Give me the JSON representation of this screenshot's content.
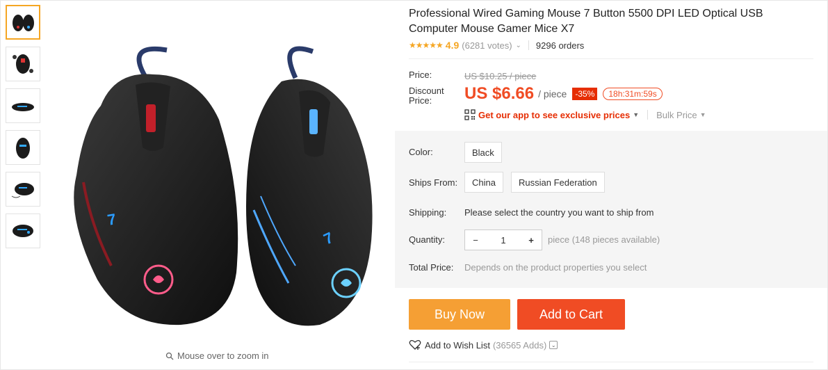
{
  "product": {
    "title": "Professional Wired Gaming Mouse 7 Button 5500 DPI LED Optical USB Computer Mouse Gamer Mice X7",
    "stars": "★★★★★",
    "rating": "4.9",
    "votes": "(6281 votes)",
    "orders": "9296 orders"
  },
  "price": {
    "price_label": "Price:",
    "original": "US $10.25 / piece",
    "discount_label_1": "Discount",
    "discount_label_2": "Price:",
    "discount_price": "US $6.66",
    "per_unit": "/ piece",
    "off": "-35%",
    "timer": "18h:31m:59s",
    "app_link": "Get our app to see exclusive prices",
    "bulk": "Bulk Price"
  },
  "properties": {
    "color_label": "Color:",
    "color_value": "Black",
    "ships_label": "Ships From:",
    "ships_options": [
      "China",
      "Russian Federation"
    ],
    "shipping_label": "Shipping:",
    "shipping_text": "Please select the country you want to ship from",
    "quantity_label": "Quantity:",
    "quantity_minus": "−",
    "quantity_value": "1",
    "quantity_plus": "+",
    "quantity_note": "piece (148 pieces available)",
    "total_label": "Total Price:",
    "total_note": "Depends on the product properties you select"
  },
  "actions": {
    "buy_now": "Buy Now",
    "add_to_cart": "Add to Cart",
    "wishlist": "Add to Wish List",
    "wishlist_adds": "(36565 Adds)"
  },
  "gallery": {
    "zoom_hint": "Mouse over to zoom in",
    "thumbnail_count": 6
  },
  "colors": {
    "accent_orange": "#f5a623",
    "price_red": "#f04c24",
    "buy_now": "#f59f34",
    "add_to_cart": "#f04c24"
  }
}
